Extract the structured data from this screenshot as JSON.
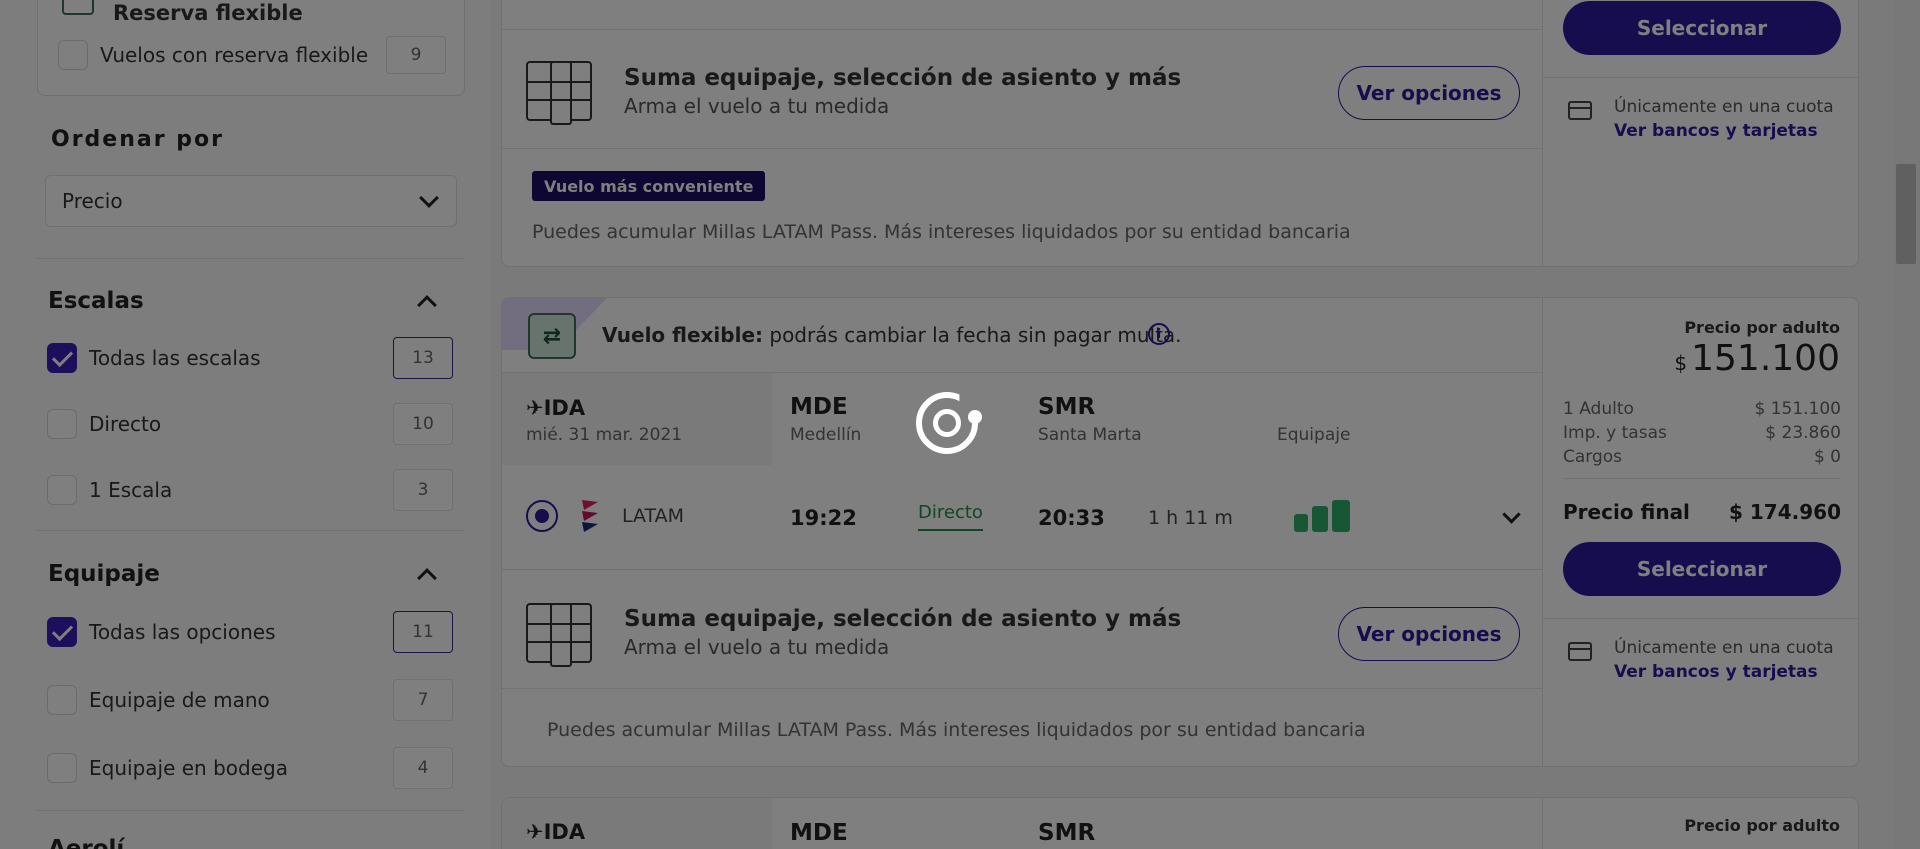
{
  "filters": {
    "flex_title": "Reserva flexible",
    "flex_option": {
      "label": "Vuelos con reserva flexible",
      "count": "9"
    },
    "sort": {
      "title": "Ordenar por",
      "selected": "Precio"
    },
    "escalas": {
      "title": "Escalas",
      "options": [
        {
          "label": "Todas las escalas",
          "count": "13",
          "checked": true
        },
        {
          "label": "Directo",
          "count": "10",
          "checked": false
        },
        {
          "label": "1 Escala",
          "count": "3",
          "checked": false
        }
      ]
    },
    "equipaje": {
      "title": "Equipaje",
      "options": [
        {
          "label": "Todas las opciones",
          "count": "11",
          "checked": true
        },
        {
          "label": "Equipaje de mano",
          "count": "7",
          "checked": false
        },
        {
          "label": "Equipaje en bodega",
          "count": "4",
          "checked": false
        }
      ]
    },
    "next_section_partial": "Aerolí"
  },
  "card1": {
    "select_label": "Seleccionar",
    "cuota": "Únicamente en una cuota",
    "bancos": "Ver bancos y tarjetas",
    "upsell_title": "Suma equipaje, selección de asiento y más",
    "upsell_sub": "Arma el vuelo a tu medida",
    "ver_opciones": "Ver opciones",
    "badge": "Vuelo más conveniente",
    "millas": "Puedes acumular Millas LATAM Pass. Más intereses liquidados por su entidad bancaria"
  },
  "card2": {
    "flex_bold": "Vuelo flexible:",
    "flex_rest": " podrás cambiar la fecha sin pagar multa.",
    "ida": "✈IDA",
    "date": "mié. 31 mar. 2021",
    "origin_code": "MDE",
    "origin_city": "Medellín",
    "dest_code": "SMR",
    "dest_city": "Santa Marta",
    "equipaje_label": "Equipaje",
    "airline": "LATAM",
    "depart": "19:22",
    "stops": "Directo",
    "arrive": "20:33",
    "duration": "1 h 11 m",
    "price_label": "Precio por adulto",
    "currency": "$",
    "price": "151.100",
    "breakdown": [
      {
        "label": "1 Adulto",
        "value": "$ 151.100"
      },
      {
        "label": "Imp. y tasas",
        "value": "$ 23.860"
      },
      {
        "label": "Cargos",
        "value": "$ 0"
      }
    ],
    "final_label": "Precio final",
    "final_value": "$ 174.960",
    "select_label": "Seleccionar",
    "cuota": "Únicamente en una cuota",
    "bancos": "Ver bancos y tarjetas",
    "upsell_title": "Suma equipaje, selección de asiento y más",
    "upsell_sub": "Arma el vuelo a tu medida",
    "ver_opciones": "Ver opciones",
    "millas": "Puedes acumular Millas LATAM Pass. Más intereses liquidados por su entidad bancaria"
  },
  "card3": {
    "ida": "✈IDA",
    "origin_code": "MDE",
    "dest_code": "SMR",
    "price_label": "Precio por adulto"
  },
  "colors": {
    "primary": "#2d1b9e",
    "badge": "#1c0f63",
    "direct": "#1e8c4d",
    "bag": "#2eaf6a"
  },
  "icons": [
    "flex-tag-icon",
    "checkbox-check-icon",
    "chevron-down-icon",
    "chevron-up-icon",
    "seat-map-icon",
    "credit-card-icon",
    "flexible-flight-icon",
    "info-icon",
    "latam-logo",
    "baggage-icon",
    "loading-spinner-icon"
  ]
}
